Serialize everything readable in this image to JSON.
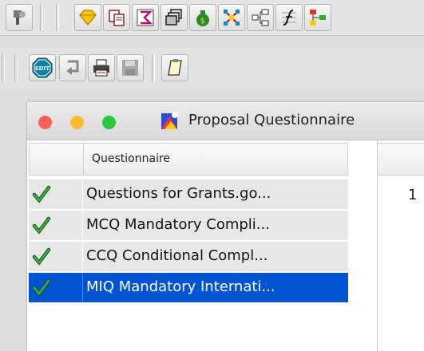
{
  "toolbar_top": {
    "buttons": [
      "tools-icon",
      "gem-icon",
      "copy-icon",
      "sigma-icon",
      "stacked-windows-icon",
      "money-bag-icon",
      "network-icon",
      "tree-icon",
      "formula-icon",
      "hierarchy-icon"
    ]
  },
  "toolbar_second": {
    "buttons": [
      "edit-icon",
      "undo-icon",
      "print-icon",
      "save-icon",
      "clipboard-icon"
    ],
    "edit_label": "EDIT"
  },
  "window": {
    "title": "Proposal Questionnaire"
  },
  "questionnaire": {
    "header": "Questionnaire",
    "rows": [
      {
        "label": "Questions for Grants.go...",
        "status": "check-icon",
        "selected": false
      },
      {
        "label": "MCQ Mandatory Compli...",
        "status": "check-icon",
        "selected": false
      },
      {
        "label": "CCQ Conditional Compl...",
        "status": "check-icon",
        "selected": false
      },
      {
        "label": "MIQ Mandatory Internati...",
        "status": "check-icon",
        "selected": true
      }
    ]
  },
  "right_pane": {
    "first_value": "1"
  },
  "colors": {
    "selection": "#0054d1",
    "close": "#fe5f57",
    "minimize": "#febc2e",
    "zoom": "#28c840",
    "check": "#2e8b2e"
  }
}
